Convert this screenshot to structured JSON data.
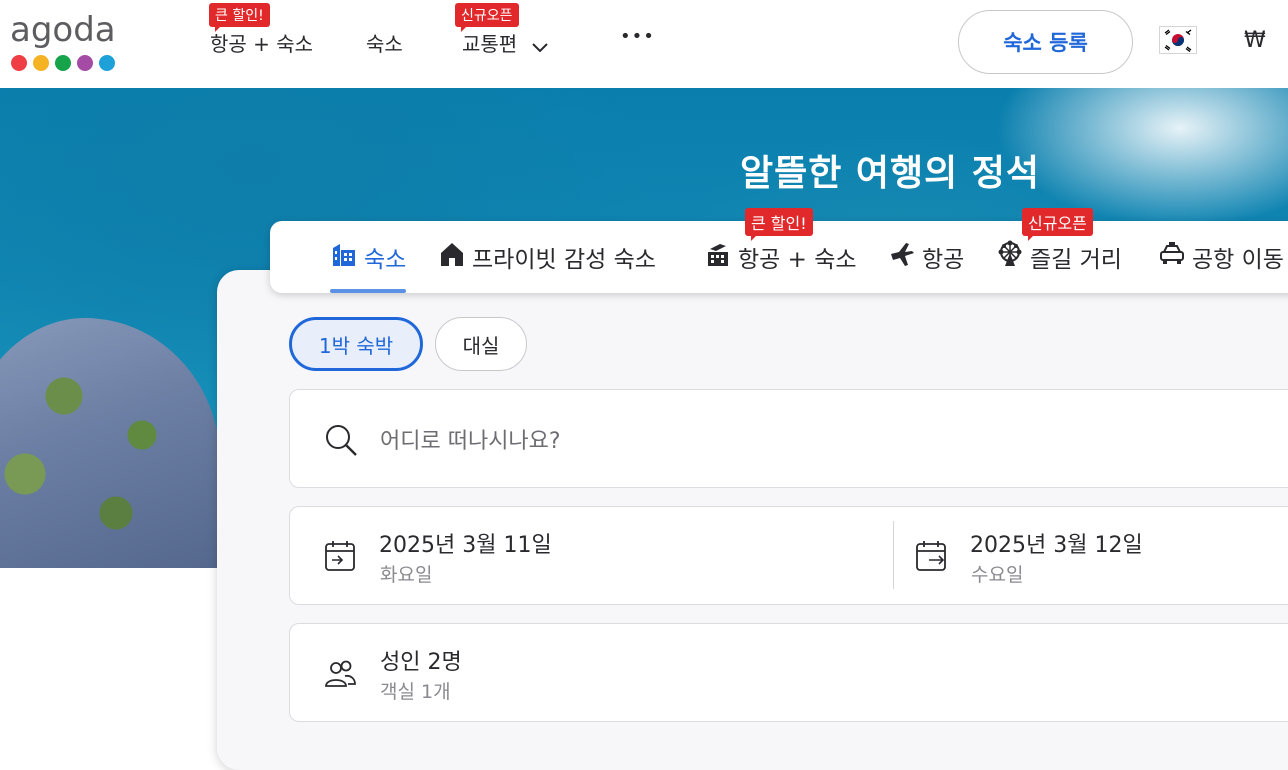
{
  "logo": {
    "text": "agoda",
    "dot_colors": [
      "#ef3f44",
      "#f5b324",
      "#16a34a",
      "#a44ba6",
      "#1ea0d8"
    ]
  },
  "nav": {
    "items": [
      {
        "label": "항공 + 숙소",
        "badge": "큰 할인!"
      },
      {
        "label": "숙소",
        "badge": ""
      },
      {
        "label": "교통편",
        "badge": "신규오픈",
        "dropdown": true
      },
      {
        "label": "•••",
        "badge": ""
      }
    ],
    "register_label": "숙소 등록",
    "flag_icon": "south-korea-flag-icon",
    "currency": "₩"
  },
  "hero": {
    "title": "알뜰한 여행의 정석"
  },
  "tabs": [
    {
      "label": "숙소",
      "icon": "hotel-building-icon",
      "active": true,
      "badge": ""
    },
    {
      "label": "프라이빗 감성 숙소",
      "icon": "house-icon",
      "active": false,
      "badge": ""
    },
    {
      "label": "항공 + 숙소",
      "icon": "flight-hotel-icon",
      "active": false,
      "badge": "큰 할인!"
    },
    {
      "label": "항공",
      "icon": "airplane-icon",
      "active": false,
      "badge": ""
    },
    {
      "label": "즐길 거리",
      "icon": "ferris-wheel-icon",
      "active": false,
      "badge": "신규오픈"
    },
    {
      "label": "공항 이동",
      "icon": "car-icon",
      "active": false,
      "badge": ""
    }
  ],
  "stay_type": {
    "options": [
      "1박 숙박",
      "대실"
    ],
    "selected": "1박 숙박"
  },
  "search": {
    "placeholder": "어디로 떠나시나요?"
  },
  "dates": {
    "checkin": {
      "date": "2025년 3월 11일",
      "weekday": "화요일"
    },
    "checkout": {
      "date": "2025년 3월 12일",
      "weekday": "수요일"
    }
  },
  "occupancy": {
    "guests": "성인 2명",
    "rooms": "객실 1개"
  },
  "colors": {
    "accent": "#2067da",
    "badge_red": "#e1292b"
  }
}
